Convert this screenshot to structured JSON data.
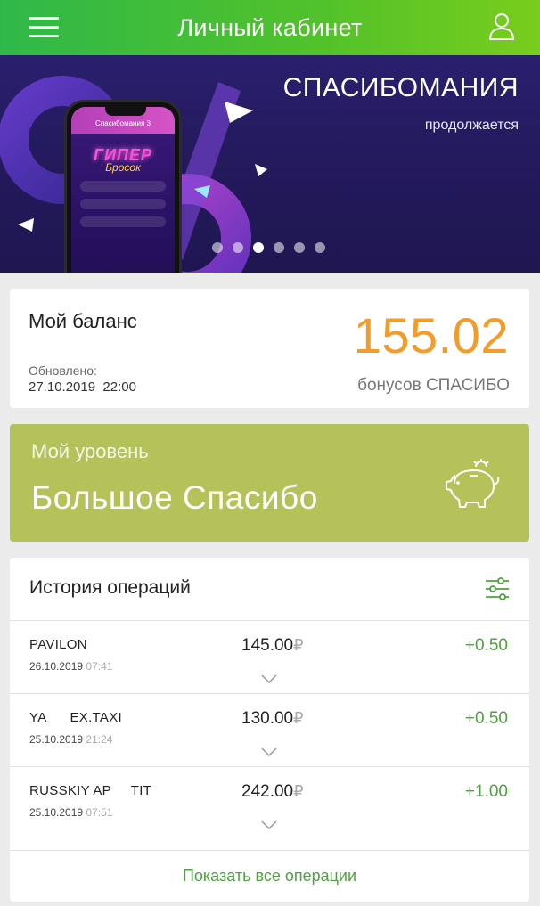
{
  "header": {
    "title": "Личный кабинет",
    "menu_icon": "hamburger-menu-icon",
    "profile_icon": "user-profile-icon"
  },
  "banner": {
    "title": "СПАСИБОМАНИЯ",
    "subtitle": "продолжается",
    "phone_header": "Спасибомания 3",
    "phone_logo": "ГИПЕР",
    "phone_logo_sub": "Бросок",
    "slides": 6,
    "active_slide": 3
  },
  "balance": {
    "label": "Мой баланс",
    "updated_label": "Обновлено:",
    "updated_date": "27.10.2019  22:00",
    "value": "155.02",
    "unit": "бонусов СПАСИБО"
  },
  "level": {
    "label": "Мой уровень",
    "value": "Большое Спасибо",
    "icon": "piggy-bank-icon"
  },
  "history": {
    "title": "История операций",
    "filter_icon": "filter-sliders-icon",
    "currency": "₽",
    "operations": [
      {
        "merchant": "PAVILON",
        "date": "26.10.2019",
        "time": "07:41",
        "amount": "145.00",
        "bonus": "+0.50"
      },
      {
        "merchant": "YA      EX.TAXI",
        "date": "25.10.2019",
        "time": "21:24",
        "amount": "130.00",
        "bonus": "+0.50"
      },
      {
        "merchant": "RUSSKIY AP     TIT",
        "date": "25.10.2019",
        "time": "07:51",
        "amount": "242.00",
        "bonus": "+1.00"
      }
    ],
    "show_all": "Показать все операции"
  },
  "colors": {
    "header_green": "#52c22a",
    "balance_orange": "#f39c2a",
    "level_olive": "#b5c25a",
    "bonus_green": "#4ba43c"
  }
}
